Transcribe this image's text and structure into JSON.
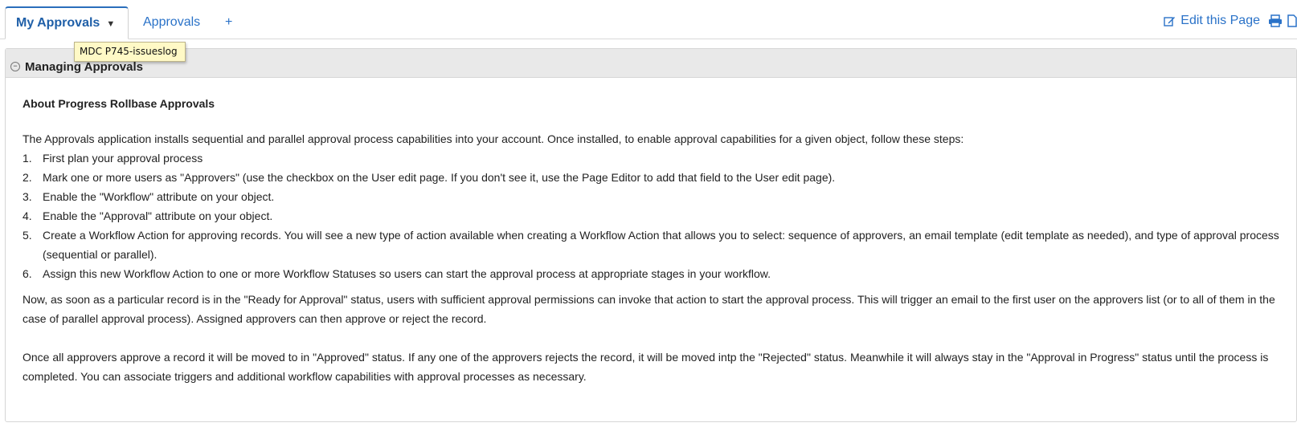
{
  "tabs": [
    {
      "label": "My Approvals"
    },
    {
      "label": "Approvals"
    },
    {
      "label": "+"
    }
  ],
  "header_actions": {
    "edit_label": "Edit this Page",
    "icons": [
      "edit-icon",
      "print-icon",
      "document-icon"
    ]
  },
  "tooltip": {
    "text": "MDC P745-issueslog"
  },
  "section": {
    "title": "Managing Approvals",
    "heading": "About Progress Rollbase Approvals",
    "intro": "The Approvals application installs sequential and parallel approval process capabilities into your account. Once installed, to enable approval capabilities for a given object, follow these steps:",
    "steps": [
      {
        "num": "1.",
        "text": "First plan your approval process"
      },
      {
        "num": "2.",
        "text": "Mark one or more users as \"Approvers\" (use the checkbox on the User edit page. If you don't see it, use the Page Editor to add that field to the User edit page)."
      },
      {
        "num": "3.",
        "text": "Enable the \"Workflow\" attribute on your object."
      },
      {
        "num": "4.",
        "text": "Enable the \"Approval\" attribute on your object."
      },
      {
        "num": "5.",
        "text": "Create a Workflow Action for approving records. You will see a new type of action available when creating a Workflow Action that allows you to select: sequence of approvers, an email template (edit template as needed), and type of approval process (sequential or parallel)."
      },
      {
        "num": "6.",
        "text": "Assign this new Workflow Action to one or more Workflow Statuses so users can start the approval process at appropriate stages in your workflow."
      }
    ],
    "paragraph1": "Now, as soon as a particular record is in the \"Ready for Approval\" status, users with sufficient approval permissions can invoke that action to start the approval process. This will trigger an email to the first user on the approvers list (or to all of them in the case of parallel approval process). Assigned approvers can then approve or reject the record.",
    "paragraph2": "Once all approvers approve a record it will be moved to in \"Approved\" status. If any one of the approvers rejects the record, it will be moved intp the \"Rejected\" status. Meanwhile it will always stay in the \"Approval in Progress\" status until the process is completed. You can associate triggers and additional workflow capabilities with approval processes as necessary."
  },
  "colors": {
    "link": "#2a72c8",
    "active_tab_border": "#2a6ebb",
    "header_bg": "#e9e9e9",
    "tooltip_bg": "#fff9c6"
  }
}
